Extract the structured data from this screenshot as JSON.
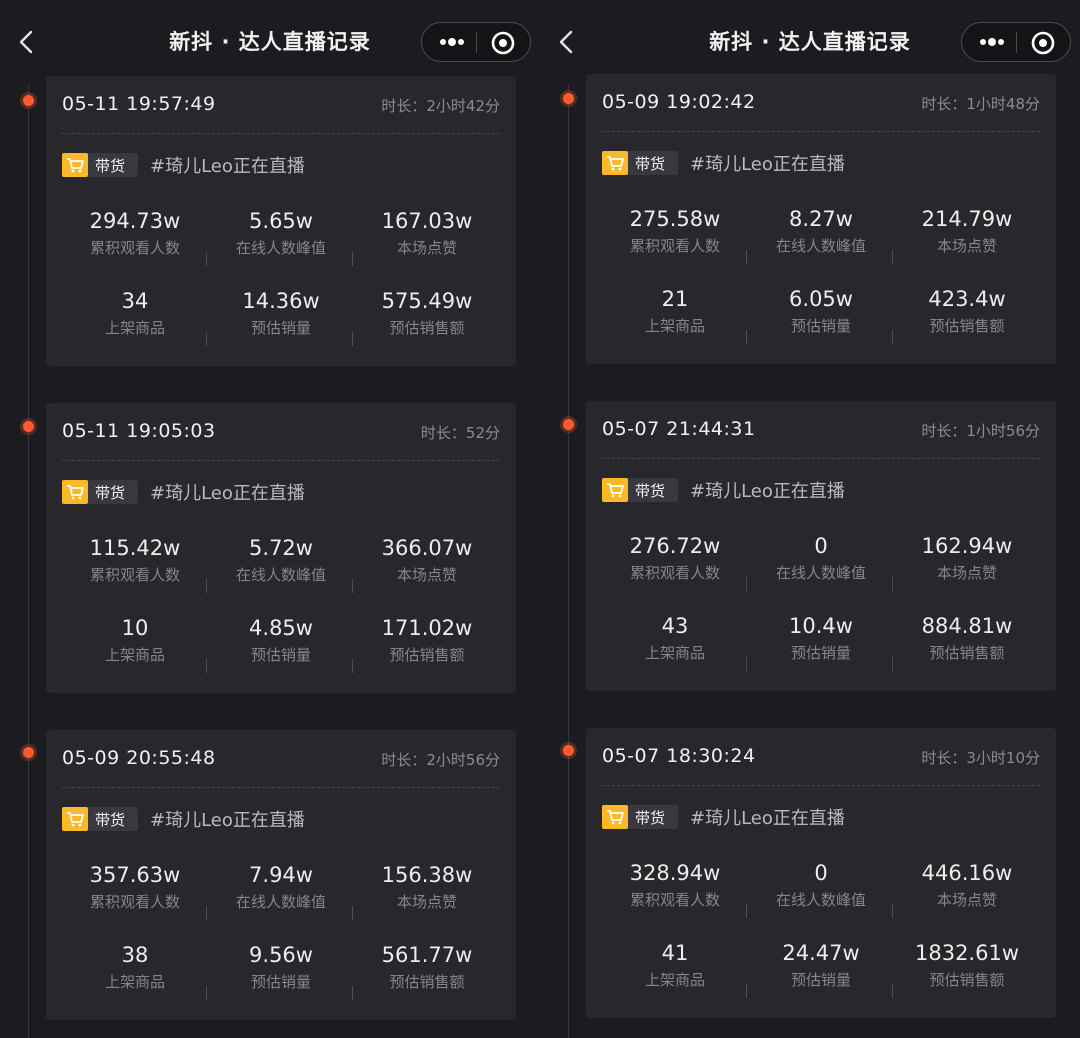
{
  "nav": {
    "title": "新抖 · 达人直播记录"
  },
  "icons": {
    "back": "chevron-left-icon",
    "more": "more-dots-icon",
    "close": "target-circle-icon",
    "cart": "shopping-cart-icon"
  },
  "colors": {
    "accent_dot": "#ff5b2c",
    "tag_yellow": "#fbb829",
    "background": "#1c1c20",
    "card": "#27272c"
  },
  "labels": {
    "duration_prefix": "时长：",
    "tag": "带货",
    "room": "#琦儿Leo正在直播",
    "viewers": "累积观看人数",
    "peak": "在线人数峰值",
    "likes": "本场点赞",
    "products": "上架商品",
    "sales": "预估销量",
    "revenue": "预估销售额"
  },
  "panels": [
    {
      "records": [
        {
          "time": "05-11 19:57:49",
          "duration": "时长：2小时42分",
          "viewers": "294.73w",
          "peak": "5.65w",
          "likes": "167.03w",
          "products": "34",
          "sales": "14.36w",
          "revenue": "575.49w"
        },
        {
          "time": "05-11 19:05:03",
          "duration": "时长：52分",
          "viewers": "115.42w",
          "peak": "5.72w",
          "likes": "366.07w",
          "products": "10",
          "sales": "4.85w",
          "revenue": "171.02w"
        },
        {
          "time": "05-09 20:55:48",
          "duration": "时长：2小时56分",
          "viewers": "357.63w",
          "peak": "7.94w",
          "likes": "156.38w",
          "products": "38",
          "sales": "9.56w",
          "revenue": "561.77w"
        }
      ]
    },
    {
      "records": [
        {
          "time": "05-09 19:02:42",
          "duration": "时长：1小时48分",
          "viewers": "275.58w",
          "peak": "8.27w",
          "likes": "214.79w",
          "products": "21",
          "sales": "6.05w",
          "revenue": "423.4w"
        },
        {
          "time": "05-07 21:44:31",
          "duration": "时长：1小时56分",
          "viewers": "276.72w",
          "peak": "0",
          "likes": "162.94w",
          "products": "43",
          "sales": "10.4w",
          "revenue": "884.81w"
        },
        {
          "time": "05-07 18:30:24",
          "duration": "时长：3小时10分",
          "viewers": "328.94w",
          "peak": "0",
          "likes": "446.16w",
          "products": "41",
          "sales": "24.47w",
          "revenue": "1832.61w"
        }
      ]
    }
  ]
}
